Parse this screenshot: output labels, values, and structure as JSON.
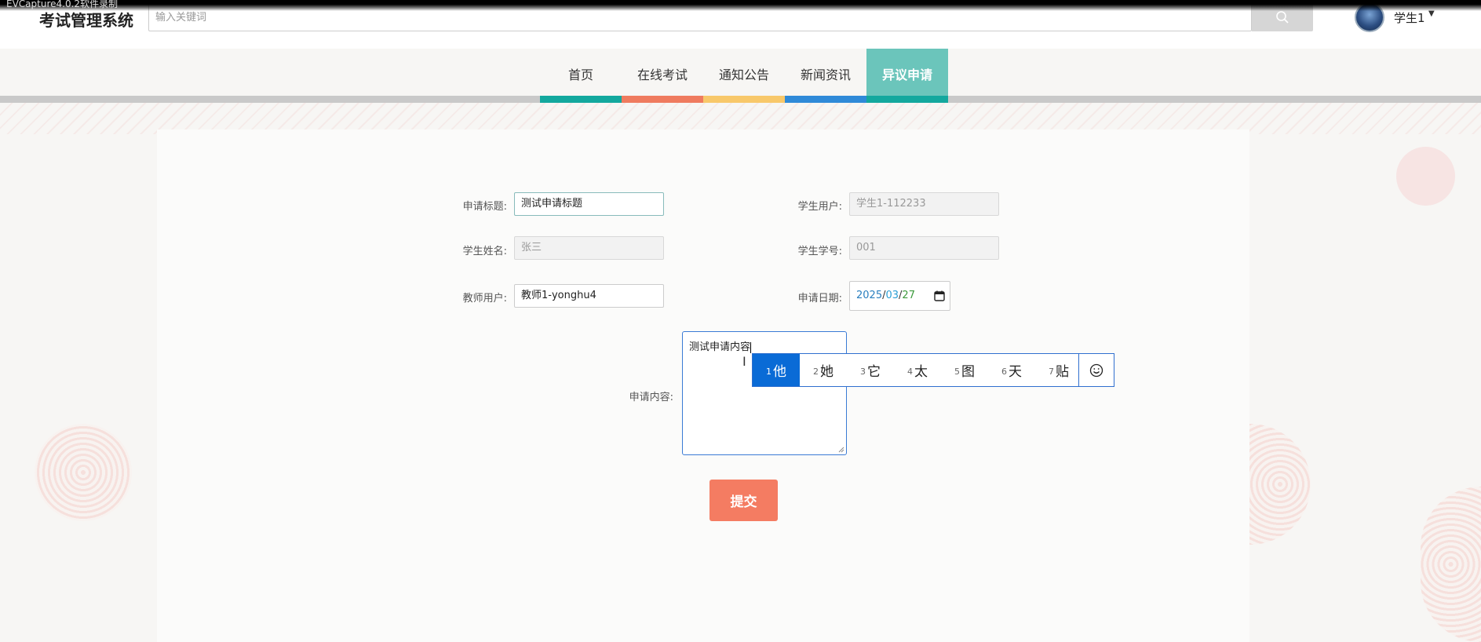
{
  "capture": {
    "title": "EVCapture4.0.2软件录制"
  },
  "header": {
    "logo": "考试管理系统",
    "search_placeholder": "输入关键词",
    "user_name": "学生1"
  },
  "nav": {
    "items": [
      {
        "label": "首页",
        "color": "#13a89e"
      },
      {
        "label": "在线考试",
        "color": "#ef7b5f"
      },
      {
        "label": "通知公告",
        "color": "#f8c86a"
      },
      {
        "label": "新闻资讯",
        "color": "#2f8ad8"
      },
      {
        "label": "异议申请",
        "color": "#13a89e"
      }
    ],
    "active_index": 4
  },
  "form": {
    "title_label": "申请标题:",
    "title_value": "测试申请标题",
    "student_user_label": "学生用户:",
    "student_user_value": "学生1-112233",
    "student_name_label": "学生姓名:",
    "student_name_value": "张三",
    "student_no_label": "学生学号:",
    "student_no_value": "001",
    "teacher_user_label": "教师用户:",
    "teacher_user_value": "教师1-yonghu4",
    "date_label": "申请日期:",
    "date_year": "2025",
    "date_month": "03",
    "date_day": "27",
    "content_label": "申请内容:",
    "content_value": "测试申请内容",
    "submit_label": "提交"
  },
  "ime": {
    "candidates": [
      {
        "num": "1",
        "char": "他"
      },
      {
        "num": "2",
        "char": "她"
      },
      {
        "num": "3",
        "char": "它"
      },
      {
        "num": "4",
        "char": "太"
      },
      {
        "num": "5",
        "char": "图"
      },
      {
        "num": "6",
        "char": "天"
      },
      {
        "num": "7",
        "char": "贴"
      }
    ],
    "selected_index": 0,
    "emoji_icon": "smiley-icon"
  }
}
